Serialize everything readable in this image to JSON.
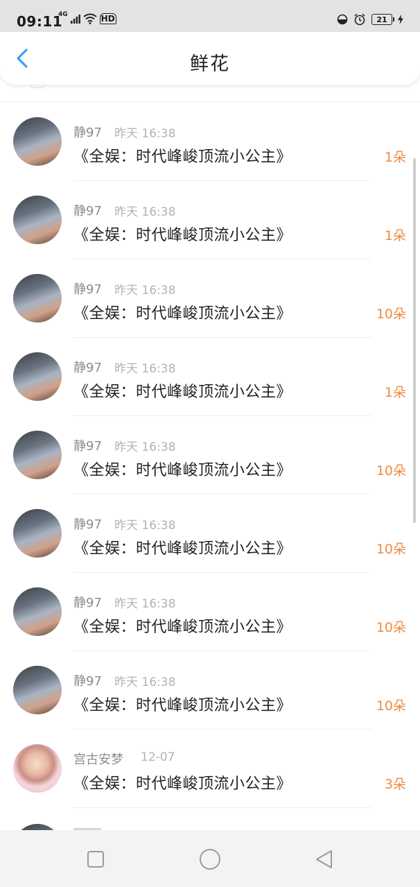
{
  "status_bar": {
    "time": "09:11",
    "network": "4G",
    "hd_label": "HD",
    "battery_level": "21"
  },
  "header": {
    "title": "鲜花",
    "back_icon": "chevron-left-icon"
  },
  "colors": {
    "accent_blue": "#3a9ff5",
    "count_orange": "#f08a3e",
    "name_gray": "#8c8c8c",
    "time_gray": "#b3b3b3"
  },
  "records": [
    {
      "user": "静97",
      "time": "昨天 16:38",
      "book": "《全娱：时代峰峻顶流小公主》",
      "count": "1朵"
    },
    {
      "user": "静97",
      "time": "昨天 16:38",
      "book": "《全娱：时代峰峻顶流小公主》",
      "count": "1朵"
    },
    {
      "user": "静97",
      "time": "昨天 16:38",
      "book": "《全娱：时代峰峻顶流小公主》",
      "count": "10朵"
    },
    {
      "user": "静97",
      "time": "昨天 16:38",
      "book": "《全娱：时代峰峻顶流小公主》",
      "count": "1朵"
    },
    {
      "user": "静97",
      "time": "昨天 16:38",
      "book": "《全娱：时代峰峻顶流小公主》",
      "count": "10朵"
    },
    {
      "user": "静97",
      "time": "昨天 16:38",
      "book": "《全娱：时代峰峻顶流小公主》",
      "count": "10朵"
    },
    {
      "user": "静97",
      "time": "昨天 16:38",
      "book": "《全娱：时代峰峻顶流小公主》",
      "count": "10朵"
    },
    {
      "user": "静97",
      "time": "昨天 16:38",
      "book": "《全娱：时代峰峻顶流小公主》",
      "count": "10朵"
    },
    {
      "user": "宫古安梦",
      "time": "12-07",
      "book": "《全娱：时代峰峻顶流小公主》",
      "count": "3朵"
    }
  ],
  "nav_bar": {
    "recent_icon": "square-icon",
    "home_icon": "circle-icon",
    "back_icon": "triangle-back-icon"
  }
}
